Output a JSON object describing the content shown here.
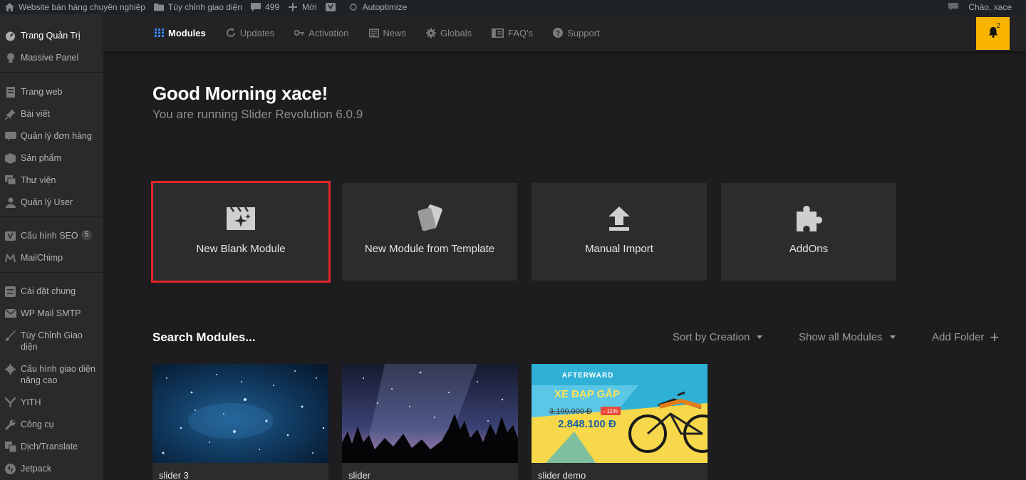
{
  "adminbar": {
    "site_name": "Website bán hàng chuyên nghiệp",
    "customize": "Tùy chỉnh giao diện",
    "comments_count": "499",
    "new_label": "Mới",
    "autoptimize": "Autoptimize",
    "greeting": "Chào, xace"
  },
  "sidebar": {
    "items": [
      {
        "label": "Trang Quản Trị",
        "icon": "dashboard-icon"
      },
      {
        "label": "Massive Panel",
        "icon": "bulb-icon"
      },
      {
        "label": "Trang web",
        "icon": "page-icon"
      },
      {
        "label": "Bài viết",
        "icon": "pin-icon"
      },
      {
        "label": "Quản lý đơn hàng",
        "icon": "woo-icon"
      },
      {
        "label": "Sản phẩm",
        "icon": "box-icon"
      },
      {
        "label": "Thư viện",
        "icon": "media-icon"
      },
      {
        "label": "Quản lý User",
        "icon": "user-icon"
      },
      {
        "label": "Cấu hình SEO",
        "icon": "yoast-icon",
        "badge": "5"
      },
      {
        "label": "MailChimp",
        "icon": "mailchimp-icon"
      },
      {
        "label": "Cài đặt chung",
        "icon": "settings-icon"
      },
      {
        "label": "WP Mail SMTP",
        "icon": "mail-icon"
      },
      {
        "label": "Tùy Chỉnh Giao diện",
        "icon": "brush-icon"
      },
      {
        "label": "Cấu hình giao diện nâng cao",
        "icon": "gear-icon"
      },
      {
        "label": "YITH",
        "icon": "yith-icon"
      },
      {
        "label": "Công cụ",
        "icon": "wrench-icon"
      },
      {
        "label": "Dịch/Translate",
        "icon": "translate-icon"
      },
      {
        "label": "Jetpack",
        "icon": "jetpack-icon"
      }
    ]
  },
  "topnav": {
    "tabs": [
      {
        "label": "Modules",
        "icon": "grid-icon",
        "active": true
      },
      {
        "label": "Updates",
        "icon": "refresh-icon"
      },
      {
        "label": "Activation",
        "icon": "key-icon"
      },
      {
        "label": "News",
        "icon": "newspaper-icon"
      },
      {
        "label": "Globals",
        "icon": "gear-icon"
      },
      {
        "label": "FAQ's",
        "icon": "book-icon"
      },
      {
        "label": "Support",
        "icon": "help-icon"
      }
    ],
    "notification_count": "2"
  },
  "main": {
    "greeting": "Good Morning xace!",
    "subtitle": "You are running Slider Revolution 6.0.9",
    "actions": [
      {
        "label": "New Blank Module",
        "icon": "clapperboard-icon",
        "highlighted": true
      },
      {
        "label": "New Module from Template",
        "icon": "template-cards-icon"
      },
      {
        "label": "Manual Import",
        "icon": "upload-icon"
      },
      {
        "label": "AddOns",
        "icon": "puzzle-icon"
      }
    ],
    "search_label": "Search Modules...",
    "sort_label": "Sort by Creation",
    "filter_label": "Show all Modules",
    "add_folder_label": "Add Folder",
    "modules": [
      {
        "name": "slider 3"
      },
      {
        "name": "slider"
      },
      {
        "name": "slider demo",
        "thumb": {
          "brand": "AFTERWARD",
          "title": "XE ĐẠP GẤP",
          "old_price": "3.190.000 Đ",
          "discount": "- 11%",
          "price": "2.848.100 Đ"
        }
      }
    ]
  },
  "colors": {
    "accent": "#3b86f2",
    "notification": "#f9b400",
    "highlight_border": "#e0262b",
    "background": "#1d1d1f",
    "card": "#2c2c2e"
  }
}
